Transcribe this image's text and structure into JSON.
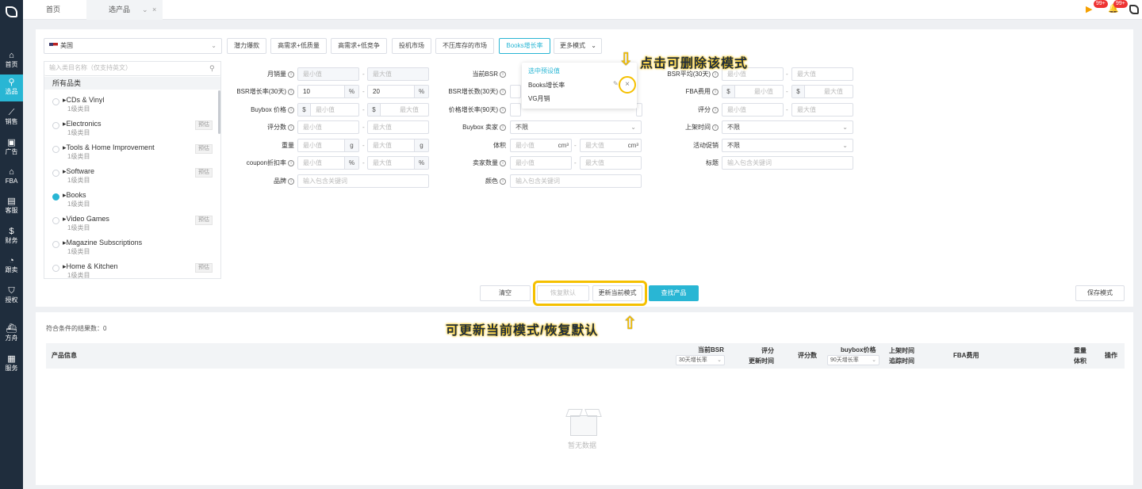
{
  "sidebar": {
    "items": [
      {
        "label": "首页",
        "icon": "home-icon"
      },
      {
        "label": "选品",
        "icon": "search-icon"
      },
      {
        "label": "销售",
        "icon": "chart-icon"
      },
      {
        "label": "广告",
        "icon": "ad-icon"
      },
      {
        "label": "FBA",
        "icon": "box-icon"
      },
      {
        "label": "客服",
        "icon": "service-icon"
      },
      {
        "label": "财务",
        "icon": "dollar-icon"
      },
      {
        "label": "跟卖",
        "icon": "pie-icon"
      },
      {
        "label": "授权",
        "icon": "shield-icon"
      },
      {
        "label": "方舟",
        "icon": "ark-icon"
      },
      {
        "label": "服务",
        "icon": "building-icon"
      }
    ]
  },
  "topbar": {
    "tabs": [
      "首页",
      "选产品"
    ],
    "badges": [
      "99+",
      "99+"
    ]
  },
  "toolbar": {
    "country": "美国",
    "modes": [
      "潜力爆款",
      "高需求+低质量",
      "高需求+低竞争",
      "投机市场",
      "不压库存的市场",
      "Books增长率"
    ],
    "more": "更多模式"
  },
  "category": {
    "placeholder": "输入类目名称（仅支持英文）",
    "all": "所有品类",
    "items": [
      {
        "name": "CDs & Vinyl",
        "sub": "1级类目",
        "tag": ""
      },
      {
        "name": "Electronics",
        "sub": "1级类目",
        "tag": "预估"
      },
      {
        "name": "Tools & Home Improvement",
        "sub": "1级类目",
        "tag": "预估"
      },
      {
        "name": "Software",
        "sub": "1级类目",
        "tag": "预估"
      },
      {
        "name": "Books",
        "sub": "1级类目",
        "tag": ""
      },
      {
        "name": "Video Games",
        "sub": "1级类目",
        "tag": "预估"
      },
      {
        "name": "Magazine Subscriptions",
        "sub": "1级类目",
        "tag": ""
      },
      {
        "name": "Home & Kitchen",
        "sub": "1级类目",
        "tag": "预估"
      }
    ]
  },
  "filters": {
    "labels": {
      "monthly_sales": "月销量",
      "bsr_growth": "BSR增长率(30天)",
      "buybox_price": "Buybox 价格",
      "rating_count": "评分数",
      "weight": "重量",
      "coupon": "coupon折扣率",
      "brand": "品牌",
      "current_bsr": "当前BSR",
      "bsr_growth_num": "BSR增长数(30天)",
      "price_growth": "价格增长率(90天)",
      "buybox_seller": "Buybox 卖家",
      "volume": "体积",
      "seller_count": "卖家数量",
      "color": "颜色",
      "bsr_avg": "BSR平均(30天)",
      "fba_fee": "FBA费用",
      "rating": "评分",
      "listing_time": "上架时间",
      "promotion": "活动促销",
      "title": "标题"
    },
    "min": "最小值",
    "max": "最大值",
    "unlimited": "不限",
    "keyword": "输入包含关键词",
    "bsr_min_value": "10",
    "bsr_max_value": "20",
    "pct": "%",
    "usd": "$",
    "g": "g",
    "cm3": "cm³",
    "dash": "-",
    "info": "i"
  },
  "dropdown": {
    "header": "选中预设值",
    "items": [
      "Books增长率",
      "VG月销"
    ],
    "close": "×"
  },
  "actions": {
    "clear": "清空",
    "restore": "恢复默认",
    "update": "更新当前模式",
    "search": "查找产品",
    "save": "保存模式"
  },
  "annotations": {
    "delete": "点击可删除该模式",
    "update": "可更新当前模式/恢复默认"
  },
  "results": {
    "count": "符合条件的结果数：0",
    "headers": {
      "product": "产品信息",
      "bsr": "当前BSR",
      "bsr_sel": "30天增长率",
      "rating": "评分",
      "rating_sub": "更新时间",
      "rating_count": "评分数",
      "buybox": "buybox价格",
      "buybox_sel": "90天增长率",
      "listing": "上架时间",
      "listing_sub": "追踪时间",
      "fba": "FBA费用",
      "weight": "重量",
      "weight_sub": "体积",
      "ops": "操作"
    },
    "empty": "暂无数据"
  },
  "colors": {
    "accent": "#29b6d4",
    "sidebar": "#1f2d3d",
    "highlight": "#f5c000"
  }
}
